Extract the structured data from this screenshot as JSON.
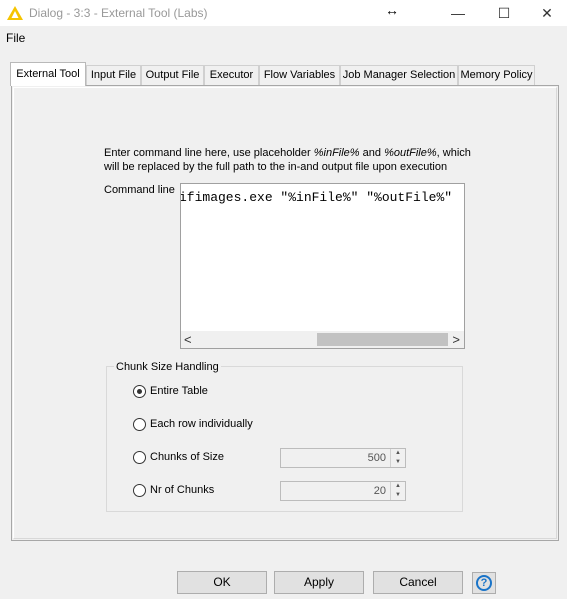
{
  "window": {
    "title": "Dialog - 3:3 - External Tool (Labs)",
    "icon": "knime-warning-triangle-icon",
    "resize_cursor": "↔",
    "min_glyph": "—",
    "max_glyph": "☐",
    "close_glyph": "✕"
  },
  "menu": {
    "file": "File"
  },
  "tabs": [
    {
      "label": "External Tool",
      "active": true
    },
    {
      "label": "Input File"
    },
    {
      "label": "Output File"
    },
    {
      "label": "Executor"
    },
    {
      "label": "Flow Variables"
    },
    {
      "label": "Job Manager Selection"
    },
    {
      "label": "Memory Policy"
    }
  ],
  "external_tool": {
    "instruction_prefix": "Enter command line here, use placeholder ",
    "placeholder_in": "%inFile%",
    "instruction_and": " and ",
    "placeholder_out": "%outFile%",
    "instruction_suffix": ", which will be replaced by the full path to the in-and output file upon execution",
    "command_label": "Command line",
    "command_value": "ifimages.exe \"%inFile%\" \"%outFile%\"",
    "scroll_left": "<",
    "scroll_right": ">"
  },
  "chunk": {
    "title": "Chunk Size Handling",
    "options": [
      {
        "label": "Entire Table",
        "checked": true
      },
      {
        "label": "Each row individually",
        "checked": false
      },
      {
        "label": "Chunks of Size",
        "checked": false,
        "value": "500"
      },
      {
        "label": "Nr of Chunks",
        "checked": false,
        "value": "20"
      }
    ],
    "spin_up": "▲",
    "spin_down": "▼"
  },
  "buttons": {
    "ok": "OK",
    "apply": "Apply",
    "cancel": "Cancel",
    "help": "?"
  },
  "colors": {
    "help_blue": "#1a74c8",
    "warning_yellow": "#f5c400"
  }
}
